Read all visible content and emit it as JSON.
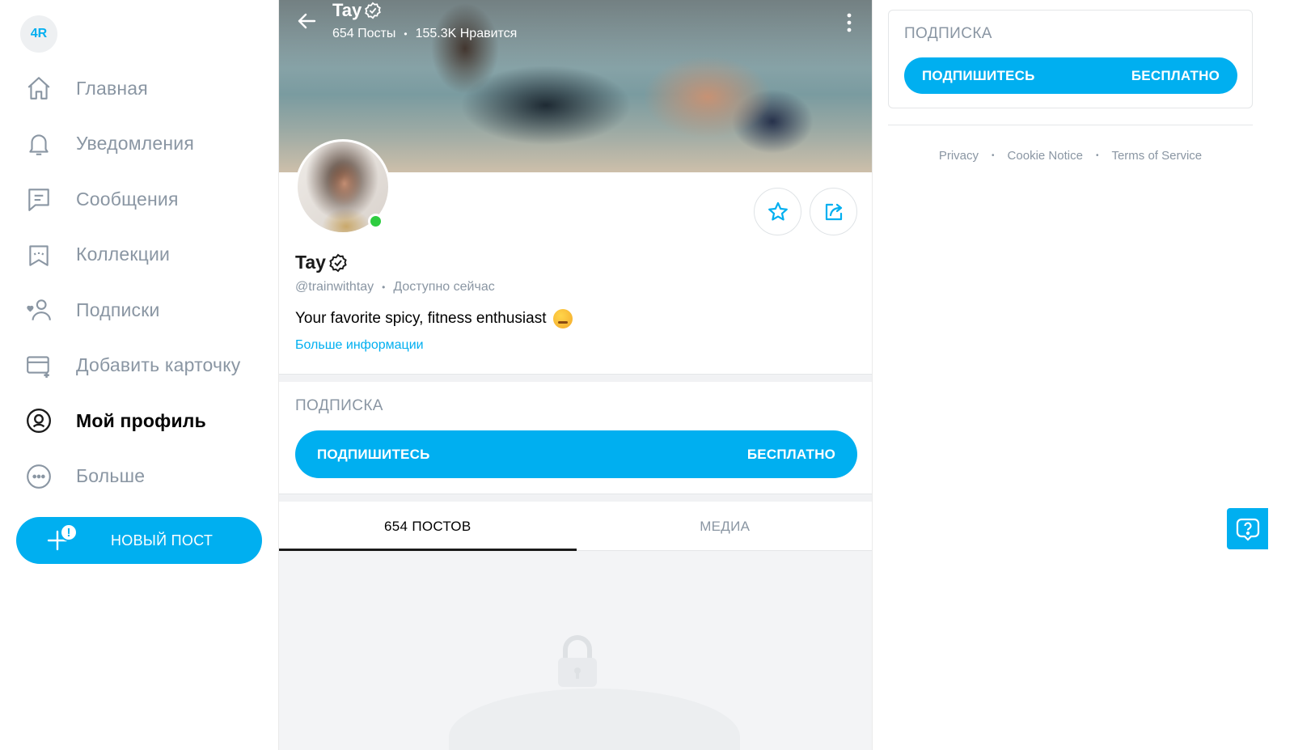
{
  "sidebar": {
    "avatar_initials": "4R",
    "items": [
      {
        "label": "Главная",
        "icon": "home-icon"
      },
      {
        "label": "Уведомления",
        "icon": "bell-icon"
      },
      {
        "label": "Сообщения",
        "icon": "message-icon"
      },
      {
        "label": "Коллекции",
        "icon": "collections-icon"
      },
      {
        "label": "Подписки",
        "icon": "subscriptions-icon"
      },
      {
        "label": "Добавить карточку",
        "icon": "add-card-icon"
      },
      {
        "label": "Мой профиль",
        "icon": "profile-icon",
        "active": true
      },
      {
        "label": "Больше",
        "icon": "more-icon"
      }
    ],
    "new_post_label": "НОВЫЙ ПОСТ",
    "new_post_alert": "!"
  },
  "profile": {
    "cover_name": "Tay",
    "cover_posts": "654 Посты",
    "cover_likes": "155.3K Нравится",
    "name": "Tay",
    "handle": "@trainwithtay",
    "status": "Доступно сейчас",
    "bio": "Your favorite spicy, fitness enthusiast",
    "more_info": "Больше информации"
  },
  "subscription": {
    "title": "ПОДПИСКА",
    "button_left": "ПОДПИШИТЕСЬ",
    "button_right": "БЕСПЛАТНО"
  },
  "tabs": [
    {
      "label": "654 ПОСТОВ",
      "active": true
    },
    {
      "label": "МЕДИА",
      "active": false
    }
  ],
  "footer": {
    "links": [
      "Privacy",
      "Cookie Notice",
      "Terms of Service"
    ]
  },
  "colors": {
    "accent": "#00aff0",
    "muted": "#8a96a3",
    "online": "#2ecc40"
  }
}
